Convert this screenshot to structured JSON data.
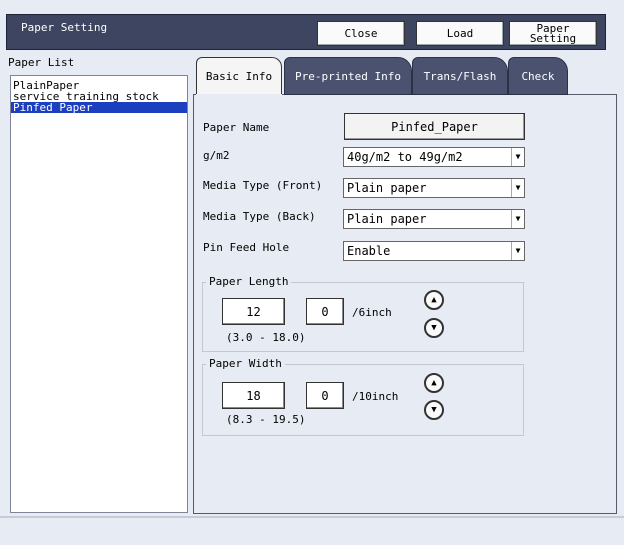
{
  "window": {
    "title": "Paper Setting"
  },
  "toolbar": {
    "close_label": "Close",
    "load_label": "Load",
    "paper_setting_line1": "Paper",
    "paper_setting_line2": "Setting"
  },
  "paper_list": {
    "label": "Paper List",
    "items": [
      "PlainPaper",
      "service_training_stock",
      "Pinfed_Paper"
    ],
    "selected_index": 2
  },
  "tabs": [
    {
      "label": "Basic Info",
      "active": true
    },
    {
      "label": "Pre-printed Info",
      "active": false
    },
    {
      "label": "Trans/Flash",
      "active": false
    },
    {
      "label": "Check",
      "active": false
    }
  ],
  "basic_info": {
    "paper_name_label": "Paper Name",
    "paper_name_value": "Pinfed_Paper",
    "gm2_label": "g/m2",
    "gm2_value": "40g/m2 to 49g/m2",
    "media_front_label": "Media Type (Front)",
    "media_front_value": "Plain paper",
    "media_back_label": "Media Type (Back)",
    "media_back_value": "Plain paper",
    "pin_feed_label": "Pin Feed Hole",
    "pin_feed_value": "Enable"
  },
  "paper_length": {
    "label": "Paper Length",
    "whole": "12",
    "fraction": "0",
    "unit": "/6inch",
    "range": "(3.0 - 18.0)"
  },
  "paper_width": {
    "label": "Paper Width",
    "whole": "18",
    "fraction": "0",
    "unit": "/10inch",
    "range": "(8.3 - 19.5)"
  },
  "colors": {
    "title_bar": "#3d4560",
    "selected_item": "#1c3fbf",
    "inactive_tab": "#4a5270",
    "background": "#e7ebf3"
  }
}
